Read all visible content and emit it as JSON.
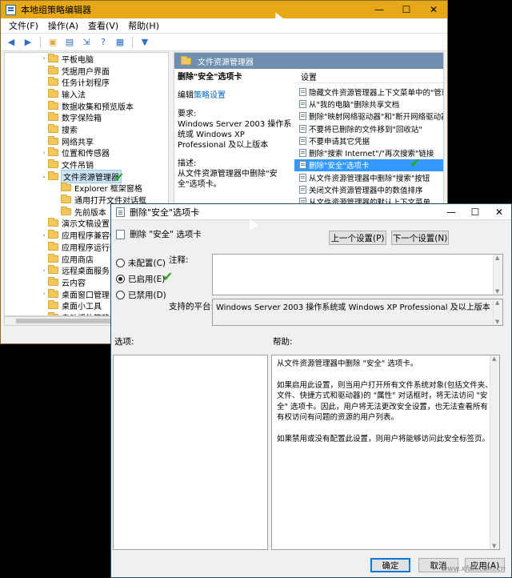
{
  "gpedit": {
    "title": "本地组策略编辑器",
    "menu": [
      "文件(F)",
      "操作(A)",
      "查看(V)",
      "帮助(H)"
    ],
    "tree": [
      {
        "label": "平板电脑",
        "arrow": "›"
      },
      {
        "label": "凭据用户界面",
        "arrow": ""
      },
      {
        "label": "任务计划程序",
        "arrow": ""
      },
      {
        "label": "输入法",
        "arrow": ""
      },
      {
        "label": "数据收集和预览版本",
        "arrow": ""
      },
      {
        "label": "数字保险箱",
        "arrow": ""
      },
      {
        "label": "搜索",
        "arrow": ""
      },
      {
        "label": "网络共享",
        "arrow": ""
      },
      {
        "label": "位置和传感器",
        "arrow": "›"
      },
      {
        "label": "文件吊销",
        "arrow": ""
      },
      {
        "label": "文件资源管理器",
        "arrow": "⌄",
        "selected": true
      },
      {
        "label": "Explorer 框架窗格",
        "arrow": "",
        "indent": true
      },
      {
        "label": "通用打开文件对话框",
        "arrow": "",
        "indent": true
      },
      {
        "label": "先前版本",
        "arrow": "",
        "indent": true
      },
      {
        "label": "演示文稿设置",
        "arrow": ""
      },
      {
        "label": "应用程序兼容性",
        "arrow": "›"
      },
      {
        "label": "应用程序运行时",
        "arrow": ""
      },
      {
        "label": "应用商店",
        "arrow": ""
      },
      {
        "label": "远程桌面服务",
        "arrow": "›"
      },
      {
        "label": "云内容",
        "arrow": ""
      },
      {
        "label": "桌面窗口管理器",
        "arrow": "›"
      },
      {
        "label": "桌面小工具",
        "arrow": ""
      },
      {
        "label": "自动播放策略",
        "arrow": ""
      }
    ],
    "right_header": "文件资源管理器",
    "desc": {
      "title": "删除\"安全\"选项卡",
      "edit_prefix": "编辑",
      "edit_link": "策略设置",
      "req_label": "要求:",
      "req_text": "Windows Server 2003 操作系统或 Windows XP Professional 及以上版本",
      "desc_label": "描述:",
      "desc_text": "从文件资源管理器中删除\"安全\"选项卡。"
    },
    "settings_header": "设置",
    "settings": [
      {
        "label": "隐藏文件资源管理器上下文菜单中的\"管理\""
      },
      {
        "label": "从\"我的电脑\"删除共享文档"
      },
      {
        "label": "删除\"映射网络驱动器\"和\"断开网络驱动器\""
      },
      {
        "label": "不要将已删除的文件移到\"回收站\""
      },
      {
        "label": "不要申请其它凭据"
      },
      {
        "label": "删除\"搜索 Internet\"/\"再次搜索\"链接"
      },
      {
        "label": "删除\"安全\"选项卡",
        "selected": true
      },
      {
        "label": "从文件资源管理器中删除\"搜索\"按钮"
      },
      {
        "label": "关闭文件资源管理器中的数值排序"
      },
      {
        "label": "从文件资源管理器的默认上下文菜单"
      }
    ]
  },
  "dialog": {
    "title": "删除\"安全\"选项卡",
    "subheader": "删除 \"安全\" 选项卡",
    "prev_button": "上一个设置(P)",
    "next_button": "下一个设置(N)",
    "radios": [
      {
        "label": "未配置(C)",
        "checked": false
      },
      {
        "label": "已启用(E)",
        "checked": true
      },
      {
        "label": "已禁用(D)",
        "checked": false
      }
    ],
    "comment_label": "注释:",
    "platform_label": "支持的平台:",
    "platform_text": "Windows Server 2003 操作系统或 Windows XP Professional 及以上版本",
    "options_label": "选项:",
    "help_label": "帮助:",
    "help_paragraphs": [
      "从文件资源管理器中删除 \"安全\" 选项卡。",
      "如果启用此设置，则当用户打开所有文件系统对象(包括文件夹、文件、快捷方式和驱动器)的 \"属性\" 对话框时，将无法访问 \"安全\" 选项卡。因此，用户将无法更改安全设置，也无法查看所有有权访问有问题的资源的用户列表。",
      "如果禁用或没有配置此设置，则用户将能够访问此安全标签页。"
    ],
    "ok_button": "确定",
    "cancel_button": "取消",
    "apply_button": "应用(A)"
  },
  "watermark": "www.xfdn.com.cn",
  "colors": {
    "gp_title_bar": "#e6a817",
    "selection": "#3399ff",
    "check": "#2ea823",
    "link": "#0066cc"
  },
  "icons": [
    "gpedit-app-icon",
    "back-arrow-icon",
    "forward-arrow-icon",
    "folder-up-icon",
    "show-hide-tree-icon",
    "export-icon",
    "help-icon",
    "properties-icon",
    "filter-icon",
    "folder-icon",
    "policy-setting-icon",
    "green-checkmark-icon"
  ]
}
